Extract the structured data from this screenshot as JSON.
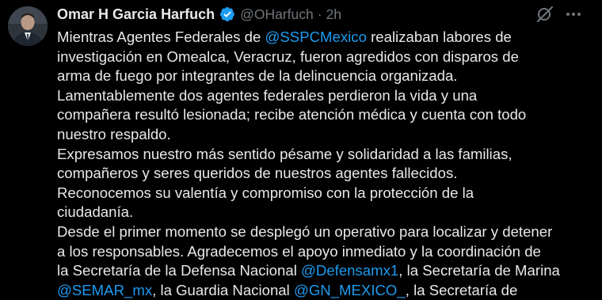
{
  "author": {
    "display_name": "Omar H Garcia Harfuch",
    "handle": "@OHarfuch",
    "separator": "·",
    "time": "2h"
  },
  "colors": {
    "background": "#000000",
    "text": "#e7e9ea",
    "secondary": "#71767b",
    "link": "#1d9bf0",
    "verified": "#1d9bf0"
  },
  "icons": {
    "verified": "verified-badge-icon",
    "grok": "grok-icon",
    "more": "more-options-icon"
  },
  "tweet": {
    "lines": [
      {
        "pre": "Mientras Agentes Federales de ",
        "mention": "@SSPCMexico",
        "post": " realizaban labores de"
      },
      {
        "pre": "investigación en Omealca, Veracruz, fueron agredidos con disparos de"
      },
      {
        "pre": "arma de fuego por integrantes de la delincuencia organizada."
      },
      {
        "pre": "Lamentablemente dos agentes federales perdieron la vida  y una"
      },
      {
        "pre": "compañera resultó lesionada; recibe atención médica y cuenta con todo"
      },
      {
        "pre": "nuestro respaldo."
      },
      {
        "pre": "Expresamos nuestro más sentido pésame y solidaridad a las familias,"
      },
      {
        "pre": "compañeros y seres queridos de nuestros agentes fallecidos."
      },
      {
        "pre": "Reconocemos su valentía y compromiso con la protección de la"
      },
      {
        "pre": "ciudadanía."
      },
      {
        "pre": "Desde el primer momento se desplegó un operativo para localizar y detener"
      },
      {
        "pre": "a los responsables. Agradecemos el apoyo inmediato y la coordinación de"
      },
      {
        "pre": "la Secretaría de la Defensa Nacional ",
        "mention": "@Defensamx1",
        "post": ", la Secretaría de Marina"
      },
      {
        "pre": "",
        "mention": "@SEMAR_mx",
        "post": ", la Guardia Nacional ",
        "mention2": "@GN_MEXICO_",
        "post2": ", la Secretaría de"
      }
    ]
  }
}
